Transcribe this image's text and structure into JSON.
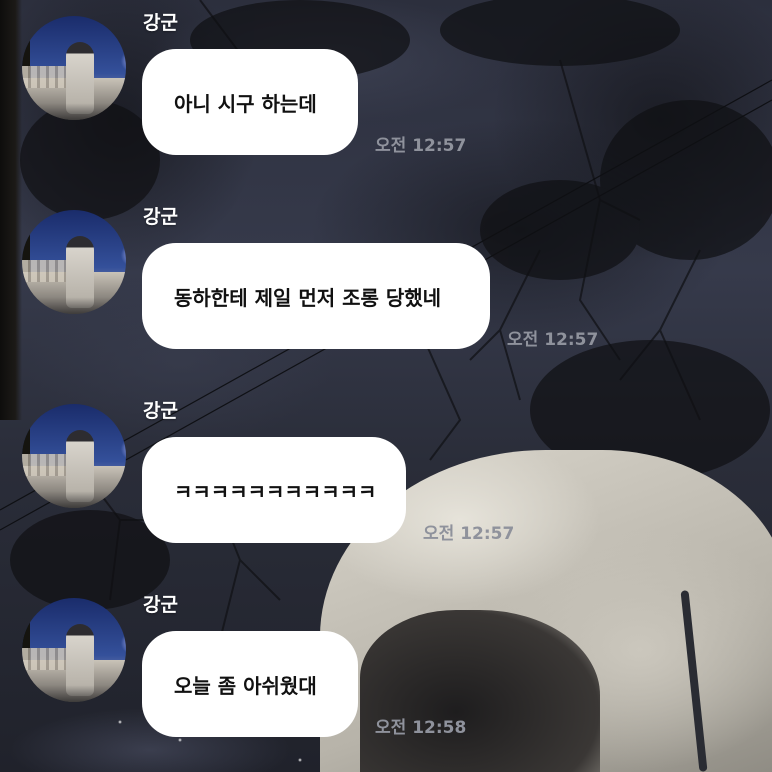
{
  "messages": [
    {
      "sender": "강군",
      "text": "아니 시구 하는데",
      "time": "오전 12:57"
    },
    {
      "sender": "강군",
      "text": "동하한테 제일 먼저 조롱 당했네",
      "time": "오전 12:57"
    },
    {
      "sender": "강군",
      "text": "ㅋㅋㅋㅋㅋㅋㅋㅋㅋㅋㅋ",
      "time": "오전 12:57"
    },
    {
      "sender": "강군",
      "text": "오늘 좀 아쉬웠대",
      "time": "오전 12:58"
    }
  ],
  "colors": {
    "bubble": "#ffffff",
    "bubble_text": "#111111",
    "sender_name": "#ffffff",
    "timestamp": "#8f929c"
  }
}
